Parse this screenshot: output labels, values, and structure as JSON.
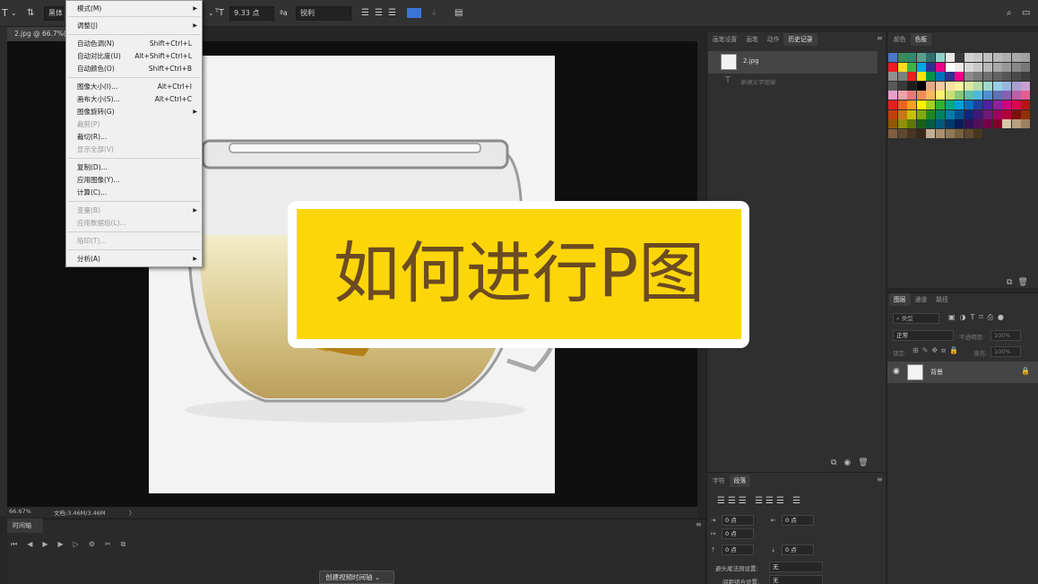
{
  "options_bar": {
    "tool_glyph": "T",
    "font_family": "黑体",
    "font_size": "9.33 点",
    "antialias": "锐利",
    "right_icons": [
      "search-icon",
      "window-icon"
    ]
  },
  "document": {
    "tab_title": "2.jpg @ 66.7%(RGB/8)",
    "zoom": "66.67%",
    "doc_info": "文档:3.46M/3.46M",
    "status_arrow": "〉"
  },
  "image_menu": {
    "items": [
      {
        "label": "模式(M)",
        "submenu": true
      },
      {
        "label": "调整(J)",
        "submenu": true
      },
      {
        "label": "自动色调(N)",
        "shortcut": "Shift+Ctrl+L"
      },
      {
        "label": "自动对比度(U)",
        "shortcut": "Alt+Shift+Ctrl+L"
      },
      {
        "label": "自动颜色(O)",
        "shortcut": "Shift+Ctrl+B"
      },
      {
        "label": "图像大小(I)...",
        "shortcut": "Alt+Ctrl+I"
      },
      {
        "label": "画布大小(S)...",
        "shortcut": "Alt+Ctrl+C"
      },
      {
        "label": "图像旋转(G)",
        "submenu": true
      },
      {
        "label": "裁剪(P)",
        "disabled": true
      },
      {
        "label": "裁切(R)..."
      },
      {
        "label": "显示全部(V)",
        "disabled": true
      },
      {
        "label": "复制(D)..."
      },
      {
        "label": "应用图像(Y)..."
      },
      {
        "label": "计算(C)..."
      },
      {
        "label": "变量(B)",
        "disabled": true,
        "submenu": true
      },
      {
        "label": "应用数据组(L)...",
        "disabled": true
      },
      {
        "label": "陷印(T)...",
        "disabled": true
      },
      {
        "label": "分析(A)",
        "submenu": true
      }
    ]
  },
  "history_panel": {
    "tabs": [
      "画笔设置",
      "画笔",
      "动作",
      "历史记录"
    ],
    "active_tab": "历史记录",
    "snapshot": "2.jpg",
    "step": "新建文字图层"
  },
  "paragraph_panel": {
    "tabs": [
      "字符",
      "段落"
    ],
    "active_tab": "段落",
    "indent_left": "0 点",
    "indent_right": "0 点",
    "indent_first": "0 点",
    "space_before": "0 点",
    "space_after": "0 点",
    "kinsoku_label": "避头尾法则设置:",
    "kinsoku_value": "无",
    "mojikumi_label": "间距组合设置:",
    "mojikumi_value": "无"
  },
  "swatches_panel": {
    "tabs": [
      "颜色",
      "色板"
    ],
    "active_tab": "色板",
    "colors": [
      "#4a78c8",
      "#3a8a5a",
      "#2e8b6e",
      "#5b9e8a",
      "#2f6f6b",
      "#8fd0c8",
      "#e8e8e8",
      "#3a3a3a",
      "#d0d0d0",
      "#c8c8c8",
      "#c0c0c0",
      "#b8b8b8",
      "#b0b0b0",
      "#a8a8a8",
      "#a0a0a0",
      "#ed1c24",
      "#ffde17",
      "#39b54a",
      "#00a6e2",
      "#2e3192",
      "#ec008c",
      "#ffffff",
      "#ebebeb",
      "#d8d8d8",
      "#c8c8c8",
      "#b8b8b8",
      "#a8a8a8",
      "#989898",
      "#888888",
      "#787878",
      "#909090",
      "#808080",
      "#ed1c24",
      "#ffde17",
      "#009245",
      "#0072bc",
      "#2e3192",
      "#ec008c",
      "#8a8a8a",
      "#7a7a7a",
      "#6e6e6e",
      "#626262",
      "#565656",
      "#4a4a4a",
      "#3e3e3e",
      "#5a5a5a",
      "#3a3a3a",
      "#1e1e1e",
      "#000000",
      "#e8a888",
      "#f4c8a0",
      "#f8e0a0",
      "#fff4a0",
      "#d8e8a0",
      "#b8dca8",
      "#a0d8c8",
      "#98d0e8",
      "#98b8e0",
      "#a8a0d0",
      "#c8a0d0",
      "#e8a0c8",
      "#f0a0a8",
      "#e87878",
      "#f08c5a",
      "#f8b860",
      "#fff070",
      "#c8e070",
      "#88c878",
      "#60c0a8",
      "#50b8e0",
      "#5090d0",
      "#6070b8",
      "#8860b0",
      "#b860a8",
      "#e06090",
      "#e82020",
      "#f06020",
      "#f8a020",
      "#fff000",
      "#a0d020",
      "#30b030",
      "#00a880",
      "#00a0d8",
      "#0070c0",
      "#2040a0",
      "#5020a0",
      "#9020a0",
      "#d00080",
      "#e00050",
      "#b01818",
      "#c04010",
      "#c87810",
      "#c8c000",
      "#80a810",
      "#208820",
      "#008060",
      "#007ca8",
      "#005090",
      "#102878",
      "#401878",
      "#701878",
      "#a00060",
      "#b00038",
      "#801010",
      "#8c3008",
      "#905808",
      "#909000",
      "#607808",
      "#186018",
      "#005c44",
      "#005878",
      "#003868",
      "#081c58",
      "#301058",
      "#501058",
      "#740048",
      "#800028",
      "#d8c8a8",
      "#b8a080",
      "#a08060",
      "#806040",
      "#604830",
      "#483420",
      "#382818",
      "#c0b090",
      "#a89070",
      "#907858",
      "#786040",
      "#604830",
      "#483620"
    ]
  },
  "layers_panel": {
    "tabs": [
      "图层",
      "通道",
      "路径"
    ],
    "active_tab": "图层",
    "filter": "类型",
    "blend_mode": "正常",
    "opacity_label": "不透明度:",
    "opacity": "100%",
    "lock_label": "锁定:",
    "fill_label": "填充:",
    "fill": "100%",
    "layer_name": "背景"
  },
  "timeline": {
    "tab": "时间轴",
    "create_button": "创建视频时间轴"
  },
  "overlay": {
    "title": "如何进行P图"
  }
}
